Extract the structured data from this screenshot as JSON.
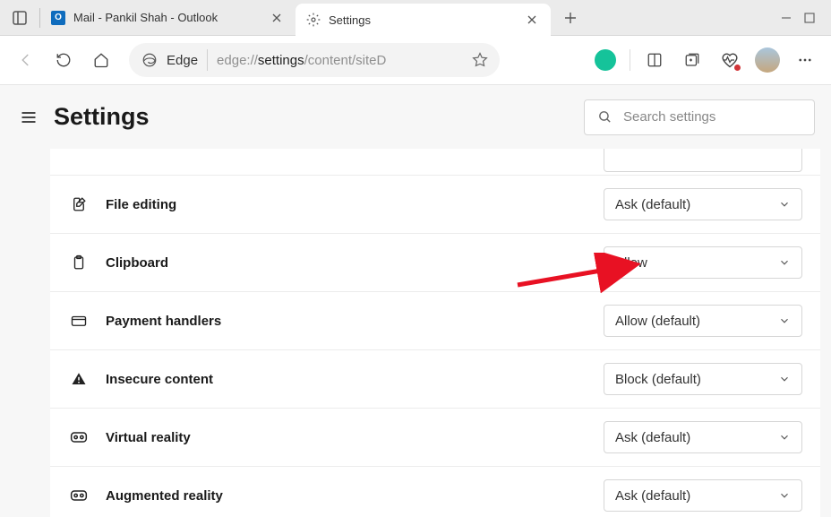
{
  "tabs": [
    {
      "title": "Mail - Pankil Shah - Outlook",
      "active": false
    },
    {
      "title": "Settings",
      "active": true
    }
  ],
  "omnibox": {
    "prefix": "Edge",
    "url_prefix": "edge://",
    "url_mid": "settings",
    "url_suffix": "/content/siteD"
  },
  "settings_header": {
    "title": "Settings",
    "search_placeholder": "Search settings"
  },
  "rows": [
    {
      "label": "File editing",
      "value": "Ask (default)",
      "icon": "file-edit"
    },
    {
      "label": "Clipboard",
      "value": "Allow",
      "icon": "clipboard",
      "highlight": true
    },
    {
      "label": "Payment handlers",
      "value": "Allow (default)",
      "icon": "credit-card"
    },
    {
      "label": "Insecure content",
      "value": "Block (default)",
      "icon": "warning"
    },
    {
      "label": "Virtual reality",
      "value": "Ask (default)",
      "icon": "vr"
    },
    {
      "label": "Augmented reality",
      "value": "Ask (default)",
      "icon": "vr"
    }
  ]
}
